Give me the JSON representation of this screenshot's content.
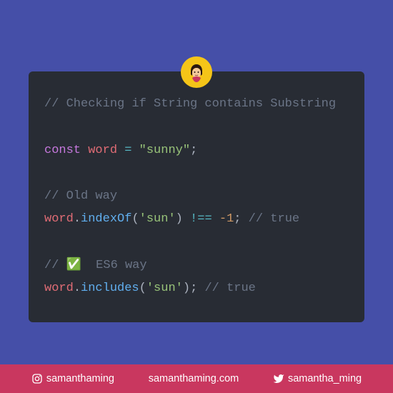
{
  "code": {
    "title_comment": "// Checking if String contains Substring",
    "const_kw": "const",
    "var_name": "word",
    "equals": " = ",
    "string_val": "\"sunny\"",
    "semi": ";",
    "old_comment": "// Old way",
    "word2": "word",
    "dot": ".",
    "indexOf": "indexOf",
    "open_paren": "(",
    "sun_arg": "'sun'",
    "close_paren": ")",
    "neq": " !== ",
    "neg1": "-1",
    "semi2": ";",
    "true_comment": " // true",
    "es6_comment": "// ✅  ES6 way",
    "word3": "word",
    "includes": "includes",
    "sun_arg2": "'sun'",
    "semi3": ";",
    "true_comment2": " // true"
  },
  "footer": {
    "instagram": "samanthaming",
    "website": "samanthaming.com",
    "twitter": "samantha_ming"
  }
}
